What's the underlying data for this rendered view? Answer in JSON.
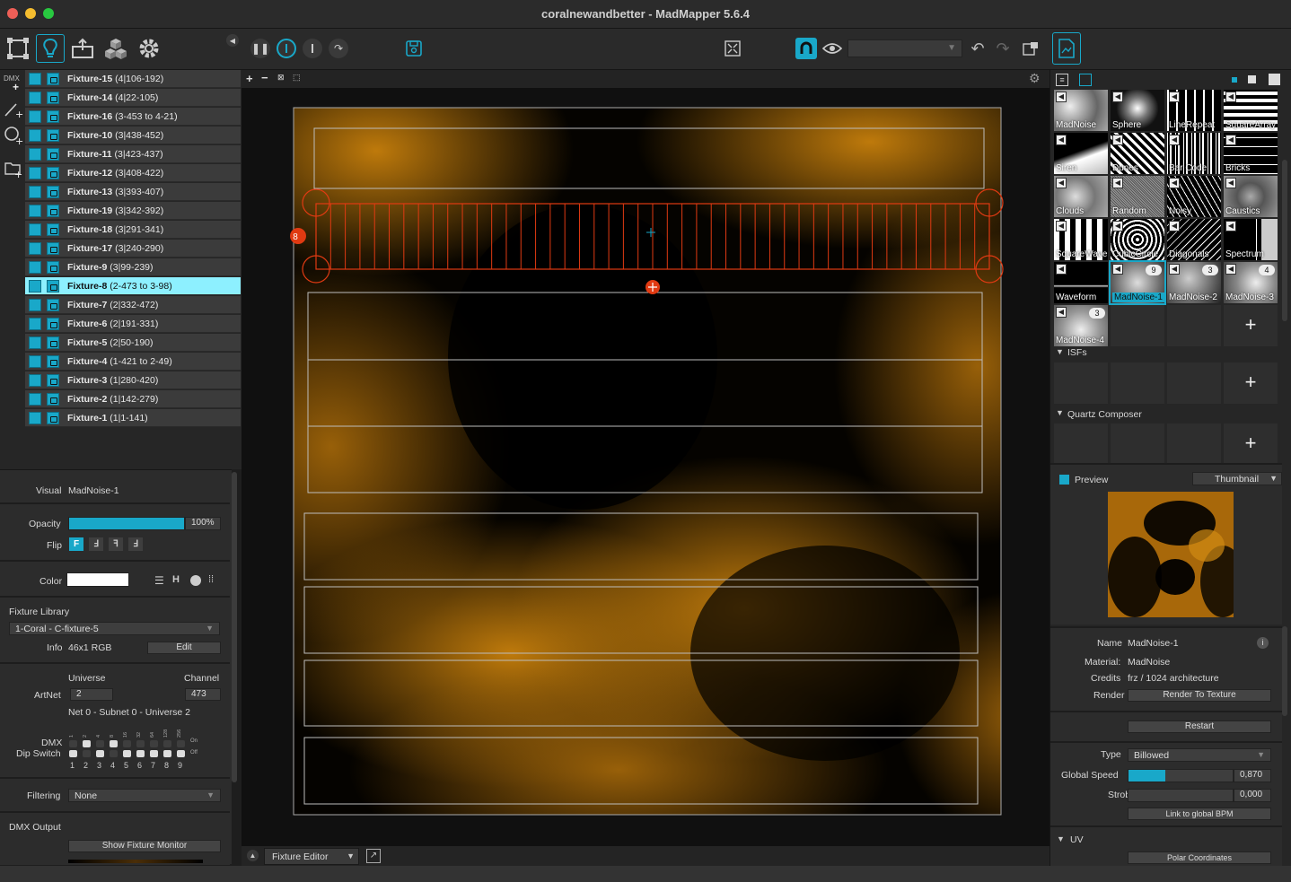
{
  "window": {
    "title": "coralnewandbetter - MadMapper 5.6.4"
  },
  "toolbar": {
    "mode_icons": [
      "mapping-mode-icon",
      "fixture-mode-icon",
      "output-mode-icon",
      "3d-mode-icon",
      "settings-icon"
    ],
    "playback": [
      "pause-icon",
      "stop-icon",
      "step-icon",
      "loop-icon"
    ]
  },
  "left_strip": {
    "dmx_label": "DMX"
  },
  "fixtures": [
    {
      "name": "Fixture-15",
      "addr": "(4|106-192)"
    },
    {
      "name": "Fixture-14",
      "addr": "(4|22-105)"
    },
    {
      "name": "Fixture-16",
      "addr": "(3-453 to 4-21)"
    },
    {
      "name": "Fixture-10",
      "addr": "(3|438-452)"
    },
    {
      "name": "Fixture-11",
      "addr": "(3|423-437)"
    },
    {
      "name": "Fixture-12",
      "addr": "(3|408-422)"
    },
    {
      "name": "Fixture-13",
      "addr": "(3|393-407)"
    },
    {
      "name": "Fixture-19",
      "addr": "(3|342-392)"
    },
    {
      "name": "Fixture-18",
      "addr": "(3|291-341)"
    },
    {
      "name": "Fixture-17",
      "addr": "(3|240-290)"
    },
    {
      "name": "Fixture-9",
      "addr": "(3|99-239)"
    },
    {
      "name": "Fixture-8",
      "addr": "(2-473 to 3-98)",
      "selected": true
    },
    {
      "name": "Fixture-7",
      "addr": "(2|332-472)"
    },
    {
      "name": "Fixture-6",
      "addr": "(2|191-331)"
    },
    {
      "name": "Fixture-5",
      "addr": "(2|50-190)"
    },
    {
      "name": "Fixture-4",
      "addr": "(1-421 to 2-49)"
    },
    {
      "name": "Fixture-3",
      "addr": "(1|280-420)"
    },
    {
      "name": "Fixture-2",
      "addr": "(1|142-279)"
    },
    {
      "name": "Fixture-1",
      "addr": "(1|1-141)"
    }
  ],
  "inspector": {
    "visual_label": "Visual",
    "visual_value": "MadNoise-1",
    "opacity_label": "Opacity",
    "opacity_value": "100%",
    "opacity_fraction": 1.0,
    "flip_label": "Flip",
    "flip_options": [
      "F",
      "Ⅎ",
      "ꟻ",
      "Ⅎ"
    ],
    "color_label": "Color",
    "color_value": "#ffffff",
    "fixture_library_label": "Fixture Library",
    "fixture_library_value": "1-Coral - C-fixture-5",
    "info_label": "Info",
    "info_value": "46x1 RGB",
    "edit_label": "Edit",
    "universe_label": "Universe",
    "channel_label": "Channel",
    "artnet_label": "ArtNet",
    "artnet_value": "2",
    "channel_value": "473",
    "net_info": "Net 0 - Subnet 0 - Universe 2",
    "dmx_label": "DMX",
    "dip_label": "Dip Switch",
    "dip_top_values": [
      "1",
      "2",
      "4",
      "8",
      "16",
      "32",
      "64",
      "128",
      "256"
    ],
    "dip_numbers": [
      "1",
      "2",
      "3",
      "4",
      "5",
      "6",
      "7",
      "8",
      "9"
    ],
    "dip_on_label": "On",
    "dip_off_label": "Off",
    "filtering_label": "Filtering",
    "filtering_value": "None",
    "dmx_output_label": "DMX Output",
    "show_monitor_label": "Show Fixture Monitor"
  },
  "viewport": {
    "bottom_mode": "Fixture Editor",
    "selected_fixture_badge": "8"
  },
  "library": {
    "materials": [
      {
        "name": "MadNoise"
      },
      {
        "name": "Sphere"
      },
      {
        "name": "LineRepeat"
      },
      {
        "name": "SquareArray"
      },
      {
        "name": "Siren"
      },
      {
        "name": "Dunes"
      },
      {
        "name": "Bar Code"
      },
      {
        "name": "Bricks"
      },
      {
        "name": "Clouds"
      },
      {
        "name": "Random"
      },
      {
        "name": "Noisy"
      },
      {
        "name": "Caustics"
      },
      {
        "name": "SquareWave"
      },
      {
        "name": "CubicCircle"
      },
      {
        "name": "Diagonals"
      },
      {
        "name": "Spectrum"
      },
      {
        "name": "Waveform"
      },
      {
        "name": "MadNoise-1",
        "badge": "9",
        "selected": true
      },
      {
        "name": "MadNoise-2",
        "badge": "3"
      },
      {
        "name": "MadNoise-3",
        "badge": "4"
      },
      {
        "name": "MadNoise-4",
        "badge": "3"
      }
    ],
    "isfs_label": "ISFs",
    "quartz_label": "Quartz Composer",
    "add_label": "+"
  },
  "preview": {
    "label": "Preview",
    "mode": "Thumbnail"
  },
  "material_props": {
    "name_label": "Name",
    "name_value": "MadNoise-1",
    "material_label": "Material:",
    "material_value": "MadNoise",
    "credits_label": "Credits",
    "credits_value": "frz / 1024 architecture",
    "render_label": "Render",
    "render_button": "Render  To Texture",
    "restart_label": "Restart",
    "type_label": "Type",
    "type_value": "Billowed",
    "global_speed_label": "Global Speed",
    "global_speed_value": "0,870",
    "global_speed_fraction": 0.35,
    "strobe_label": "Strobe",
    "strobe_value": "0,000",
    "link_bpm_label": "Link to global BPM",
    "uv_label": "UV",
    "polar_label": "Polar Coordinates"
  }
}
